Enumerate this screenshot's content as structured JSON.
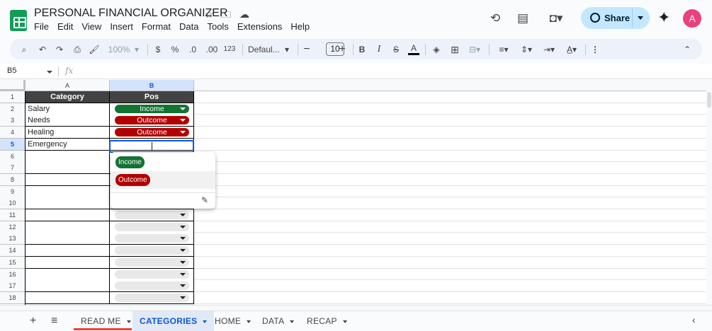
{
  "header": {
    "title": "PERSONAL FINANCIAL ORGANIZER",
    "menu": [
      "File",
      "Edit",
      "View",
      "Insert",
      "Format",
      "Data",
      "Tools",
      "Extensions",
      "Help"
    ],
    "share_label": "Share",
    "avatar_letter": "A"
  },
  "toolbar": {
    "zoom": "100%",
    "currency": "$",
    "percent": "%",
    "dec_decrease": ".0",
    "dec_increase": ".00",
    "format_123": "123",
    "font": "Defaul...",
    "font_size": "10",
    "bold": "B",
    "italic": "I",
    "strike": "S",
    "text_color": "A"
  },
  "formula_bar": {
    "name_box": "B5",
    "fx": "fx",
    "content": ""
  },
  "grid": {
    "columns": [
      "A",
      "B"
    ],
    "rows": [
      "1",
      "2",
      "3",
      "4",
      "5",
      "6",
      "7",
      "8",
      "9",
      "10",
      "11",
      "12",
      "13",
      "14",
      "15",
      "16",
      "17",
      "18"
    ],
    "selected_row": "5",
    "selected_col": "B",
    "headers": {
      "a": "Category",
      "b": "Pos"
    },
    "categories": [
      "Salary",
      "Needs",
      "Healing",
      "Emergency"
    ],
    "pos": [
      "Income",
      "Outcome",
      "Outcome"
    ]
  },
  "dropdown": {
    "options": [
      {
        "label": "Income",
        "color": "#137333"
      },
      {
        "label": "Outcome",
        "color": "#b10202"
      }
    ]
  },
  "colors": {
    "income": "#137333",
    "outcome": "#b10202",
    "accent": "#0b57d0"
  },
  "sheets": {
    "tabs": [
      "READ ME",
      "CATEGORIES",
      "HOME",
      "DATA",
      "RECAP"
    ],
    "active": "CATEGORIES"
  }
}
